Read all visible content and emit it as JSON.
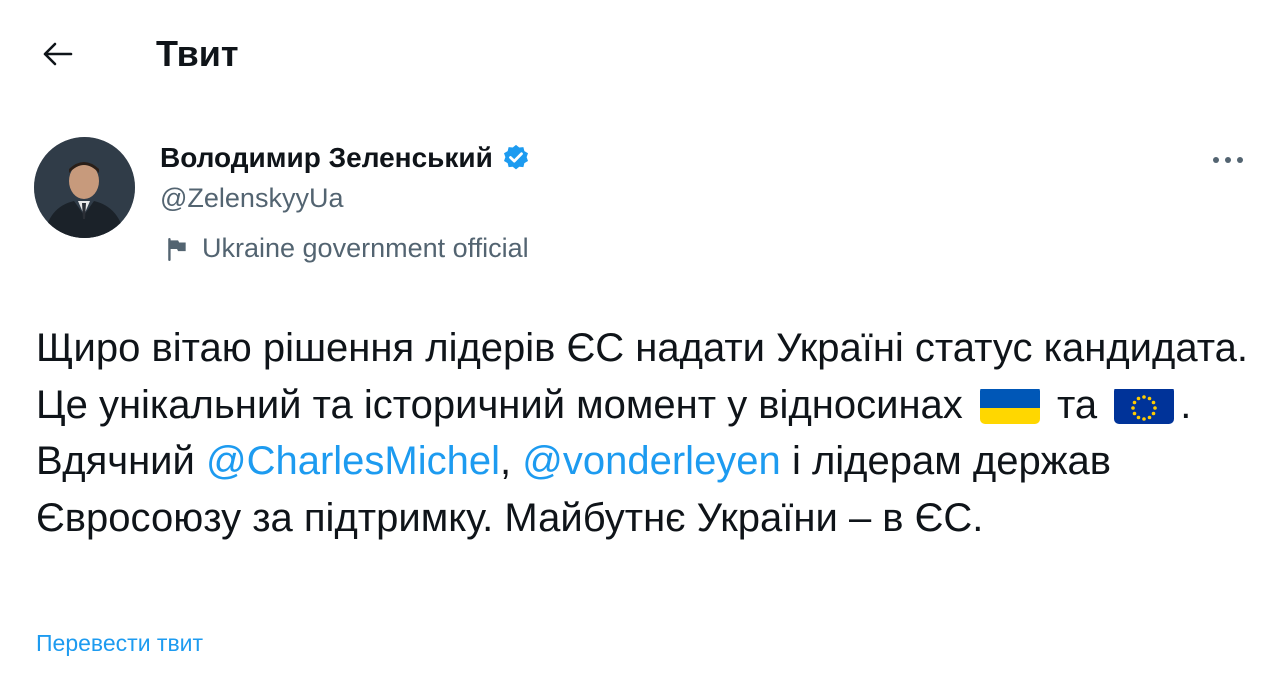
{
  "header": {
    "title": "Твит",
    "back_icon": "arrow-left-icon"
  },
  "tweet": {
    "author_name": "Володимир Зеленський",
    "handle": "@ZelenskyyUa",
    "label": "Ukraine government official",
    "text_parts": {
      "p1": "Щиро вітаю рішення лідерів ЄС надати Україні статус кандидата. Це унікальний та історичний момент у відносинах",
      "p2": "та",
      "p3": ". Вдячний",
      "mention1": "@CharlesMichel",
      "p4": ",",
      "mention2": "@vonderleyen",
      "p5": "і лідерам держав Євросоюзу за підтримку. Майбутнє України – в ЄС."
    },
    "translate_link": "Перевести твит",
    "colors": {
      "link": "#1d9bf0",
      "secondary": "#536471",
      "verified": "#1d9bf0",
      "ukraine_blue": "#0057b7",
      "ukraine_yellow": "#ffd700",
      "eu_blue": "#003399",
      "eu_star": "#ffcc00"
    },
    "icons": {
      "verified": "verified-badge-icon",
      "flag": "flag-icon",
      "more": "more-options-icon"
    }
  }
}
